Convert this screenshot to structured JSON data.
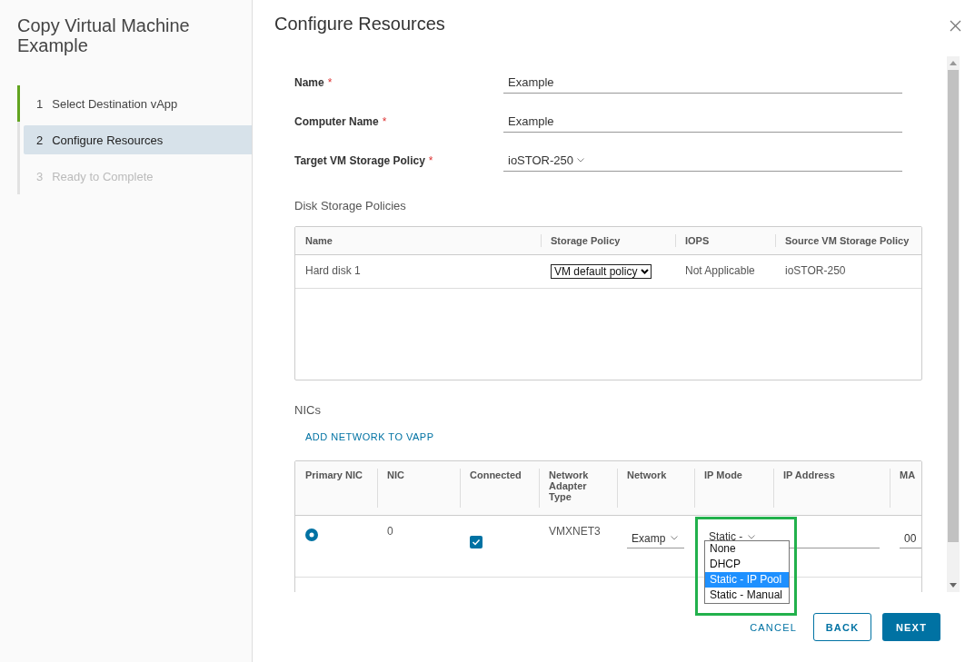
{
  "wizard": {
    "title": "Copy Virtual Machine Example",
    "steps": [
      {
        "number": "1",
        "label": "Select Destination vApp",
        "selected": false,
        "completed": true,
        "disabled": false
      },
      {
        "number": "2",
        "label": "Configure Resources",
        "selected": true,
        "completed": false,
        "disabled": false
      },
      {
        "number": "3",
        "label": "Ready to Complete",
        "selected": false,
        "completed": false,
        "disabled": true
      }
    ]
  },
  "page": {
    "title": "Configure Resources"
  },
  "form": [
    {
      "label": "Name",
      "required_mark": "*",
      "kind": "text",
      "value": "Example"
    },
    {
      "label": "Computer Name",
      "required_mark": "*",
      "kind": "text",
      "value": "Example"
    },
    {
      "label": "Target VM Storage Policy",
      "required_mark": "*",
      "kind": "select",
      "value": "ioSTOR-250"
    }
  ],
  "disk_policies": {
    "title": "Disk Storage Policies",
    "columns": [
      "Name",
      "Storage Policy",
      "IOPS",
      "Source VM Storage Policy"
    ],
    "rows": [
      {
        "name": "Hard disk 1",
        "storage_policy": "VM default policy",
        "iops": "Not Applicable",
        "source_policy": "ioSTOR-250"
      }
    ]
  },
  "nics": {
    "title": "NICs",
    "add_link": "ADD NETWORK TO VAPP",
    "columns": [
      "Primary NIC",
      "NIC",
      "Connected",
      "Network Adapter Type",
      "Network",
      "IP Mode",
      "IP Address",
      "MA"
    ],
    "rows": [
      {
        "primary": true,
        "nic": "0",
        "connected": true,
        "adapter_type": "VMXNET3",
        "network": "Examp",
        "ip_mode": "Static -",
        "mac": "00"
      }
    ],
    "ip_mode_options": [
      {
        "label": "None",
        "selected": false
      },
      {
        "label": "DHCP",
        "selected": false
      },
      {
        "label": "Static - IP Pool",
        "selected": true
      },
      {
        "label": "Static - Manual",
        "selected": false
      }
    ]
  },
  "buttons": [
    {
      "label": "CANCEL",
      "kind": "link"
    },
    {
      "label": "BACK",
      "kind": "outline"
    },
    {
      "label": "NEXT",
      "kind": "primary"
    }
  ]
}
